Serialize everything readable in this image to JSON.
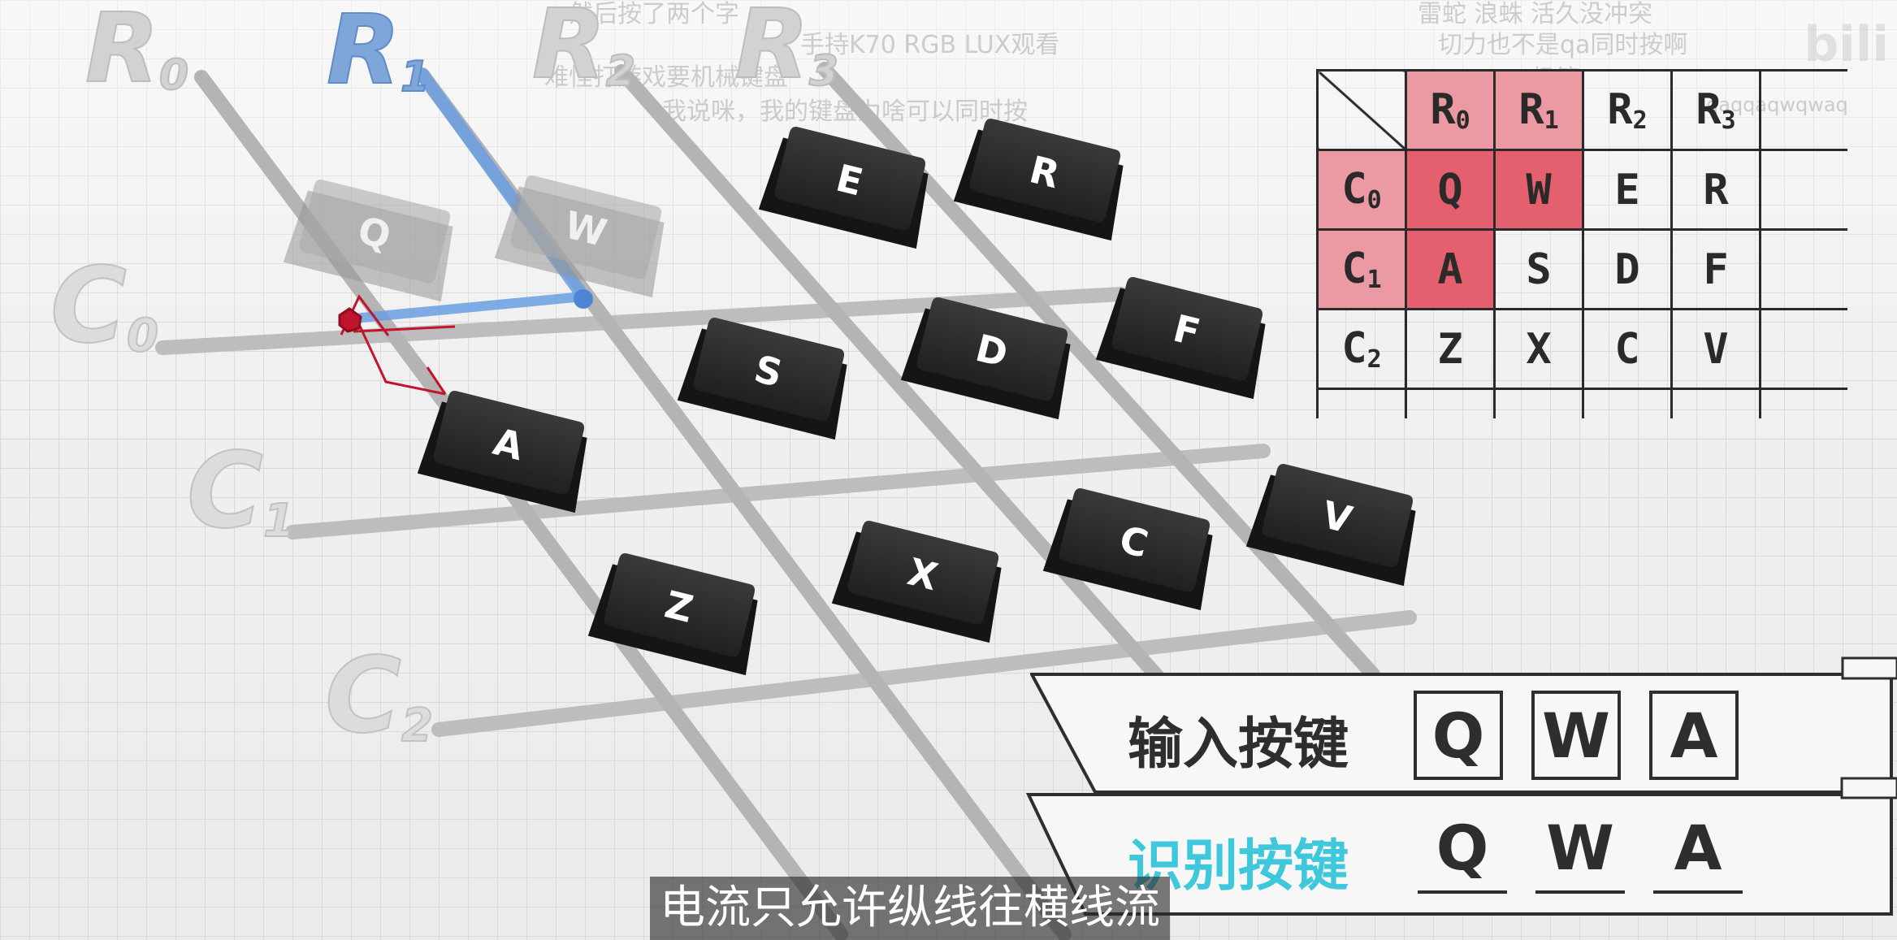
{
  "danmaku": [
    "然后按了两个字",
    "手持K70 RGB LUX观看",
    "难怪打游戏要机械键盘",
    "我说咪，我的键盘为啥可以同时按",
    "雷蛇  浪蛛  活久没冲突",
    "切力也不是qa同时按啊",
    "一极管",
    "qaqqaqwqwaq"
  ],
  "watermark": "bili",
  "rows": [
    "R0",
    "R1",
    "R2",
    "R3"
  ],
  "row_main": "R",
  "row_subs": [
    "0",
    "1",
    "2",
    "3"
  ],
  "cols": [
    "C0",
    "C1",
    "C2"
  ],
  "col_main": "C",
  "col_subs": [
    "0",
    "1",
    "2"
  ],
  "keys": [
    {
      "label": "Q",
      "pressed": true
    },
    {
      "label": "W",
      "pressed": true
    },
    {
      "label": "E",
      "pressed": false
    },
    {
      "label": "R",
      "pressed": false
    },
    {
      "label": "A",
      "pressed": true
    },
    {
      "label": "S",
      "pressed": false
    },
    {
      "label": "D",
      "pressed": false
    },
    {
      "label": "F",
      "pressed": false
    },
    {
      "label": "Z",
      "pressed": false
    },
    {
      "label": "X",
      "pressed": false
    },
    {
      "label": "C",
      "pressed": false
    },
    {
      "label": "V",
      "pressed": false
    }
  ],
  "matrix": {
    "header": [
      "R0",
      "R1",
      "R2",
      "R3"
    ],
    "row_labels": [
      "C0",
      "C1",
      "C2"
    ],
    "cells": [
      [
        "Q",
        "W",
        "E",
        "R"
      ],
      [
        "A",
        "S",
        "D",
        "F"
      ],
      [
        "Z",
        "X",
        "C",
        "V"
      ]
    ],
    "highlight_color": "#e5606f",
    "highlight_header_color": "#eb9aa3"
  },
  "input_panel": {
    "label": "输入按键",
    "keys": [
      "Q",
      "W",
      "A"
    ]
  },
  "detect_panel": {
    "label": "识别按键",
    "keys": [
      "Q",
      "W",
      "A"
    ],
    "label_color": "#3fc8dc"
  },
  "subtitle": "电流只允许纵线往横线流",
  "colors": {
    "active_row": "#6a9fe0",
    "current_path": "#c0152a",
    "rod": "#b8b8b8",
    "key": "#2a2a2a"
  }
}
